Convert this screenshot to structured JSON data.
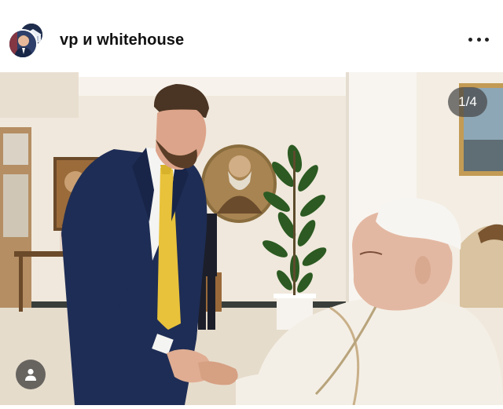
{
  "header": {
    "username": "vp и whitehouse",
    "avatars": [
      "vp-avatar",
      "whitehouse-avatar"
    ],
    "more_icon": "more-horizontal-icon"
  },
  "photo": {
    "counter": "1/4",
    "tag_icon": "user-tag-icon"
  },
  "colors": {
    "suit": "#1e2d55",
    "tie": "#e8c23a",
    "cassock": "#f4efe6",
    "wall": "#f0e8dc"
  }
}
